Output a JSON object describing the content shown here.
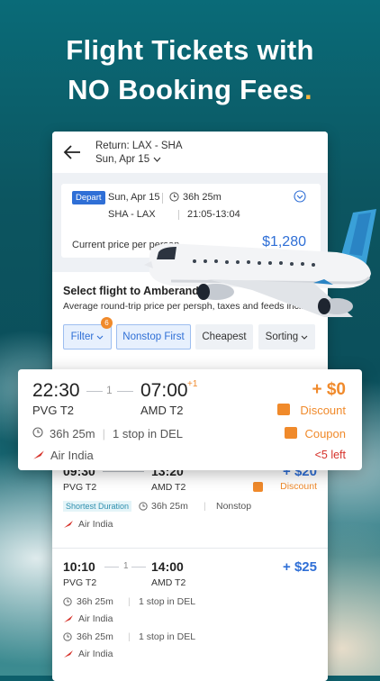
{
  "headline": {
    "line1": "Flight Tickets with",
    "line2": "NO Booking Fees",
    "dot": "."
  },
  "header": {
    "route": "Return: LAX - SHA",
    "date": "Sun, Apr 15"
  },
  "depart_card": {
    "badge": "Depart",
    "date": "Sun, Apr 15",
    "duration": "36h 25m",
    "route": "SHA - LAX",
    "times": "21:05-13:04",
    "price_label": "Current price per person",
    "price": "$1,280"
  },
  "select": {
    "title": "Select flight to Amberand",
    "subtitle": "Average round-trip price per persph, taxes and feeds incl.",
    "chips": {
      "filter": "Filter",
      "filter_badge": "6",
      "nonstop": "Nonstop First",
      "cheapest": "Cheapest",
      "sorting": "Sorting"
    }
  },
  "highlight": {
    "dep_time": "22:30",
    "stops": "1",
    "arr_time": "07:00",
    "next_day": "+1",
    "dep_apt": "PVG T2",
    "arr_apt": "AMD T2",
    "price": "+ $0",
    "discount": "Discount",
    "duration": "36h 25m",
    "stop_info": "1 stop in DEL",
    "coupon": "Coupon",
    "airline": "Air India",
    "seats_left": "<5 left"
  },
  "flights": [
    {
      "dep_time": "09:30",
      "arr_time": "13:20",
      "dep_apt": "PVG T2",
      "arr_apt": "AMD T2",
      "price": "+ $20",
      "discount": "Discount",
      "tag": "Shortest Duration",
      "duration": "36h 25m",
      "stop_info": "Nonstop",
      "airline": "Air India"
    },
    {
      "dep_time": "10:10",
      "stops": "1",
      "arr_time": "14:00",
      "dep_apt": "PVG T2",
      "arr_apt": "AMD T2",
      "price": "+ $25",
      "duration": "36h 25m",
      "stop_info": "1 stop in DEL",
      "airline": "Air India",
      "duration2": "36h 25m",
      "stop_info2": "1 stop in DEL",
      "airline2": "Air India"
    }
  ],
  "colors": {
    "accent": "#2f6fd6",
    "orange": "#f08a2b",
    "red": "#d6322a",
    "headline_dot": "#f6b43c"
  }
}
